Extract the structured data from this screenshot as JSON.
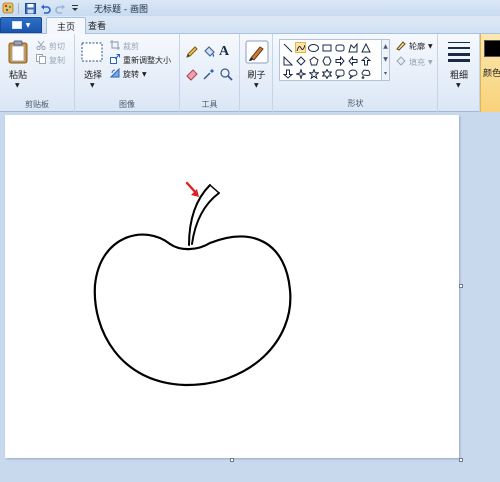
{
  "window": {
    "title": "无标题 - 画图"
  },
  "tabs": [
    {
      "label": "主页",
      "active": true
    },
    {
      "label": "查看",
      "active": false
    }
  ],
  "ribbon": {
    "clipboard": {
      "paste_label": "粘贴",
      "cut_label": "剪切",
      "copy_label": "复制",
      "group_label": "剪贴板"
    },
    "image": {
      "select_label": "选择",
      "crop_label": "裁剪",
      "resize_label": "重新调整大小",
      "rotate_label": "旋转",
      "group_label": "图像"
    },
    "tools": {
      "group_label": "工具",
      "text_tool_glyph": "A"
    },
    "brushes": {
      "label": "刷子"
    },
    "shapes": {
      "outline_label": "轮廓",
      "fill_label": "填充",
      "group_label": "形状"
    },
    "size": {
      "label": "粗细"
    },
    "color": {
      "label": "颜色"
    }
  },
  "colors": {
    "ribbon_accent": "#1c56ad",
    "stroke": "#000000",
    "selection_arrow": "#e02020",
    "canvas": "#ffffff",
    "workspace": "#c8d9ee"
  }
}
